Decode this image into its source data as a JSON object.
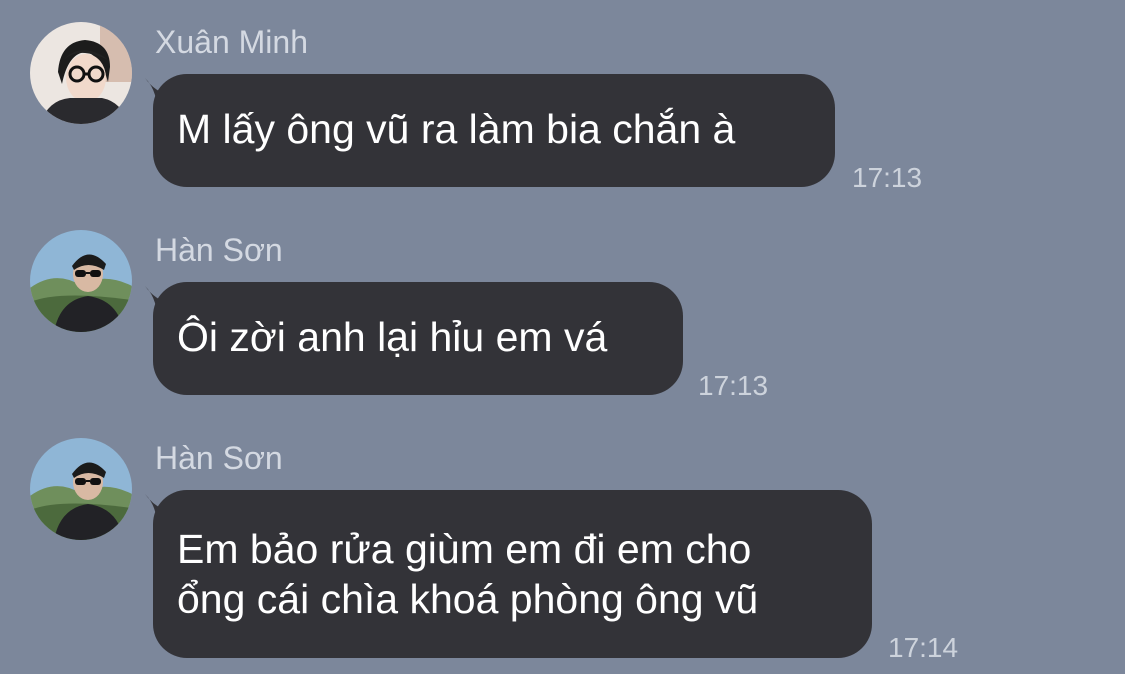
{
  "chat": {
    "background_color": "#7c879b",
    "bubble_color": "#333338",
    "messages": [
      {
        "sender": "Xuân Minh",
        "avatar_icon": "user-avatar-icon",
        "text_lines": [
          "M lấy ông vũ ra làm bia chắn à"
        ],
        "time": "17:13"
      },
      {
        "sender": "Hàn Sơn",
        "avatar_icon": "user-avatar-icon",
        "text_lines": [
          "Ôi zời anh lại hỉu em vá"
        ],
        "time": "17:13"
      },
      {
        "sender": "Hàn Sơn",
        "avatar_icon": "user-avatar-icon",
        "text_lines": [
          "Em bảo rửa giùm em đi em cho",
          "ổng cái chìa khoá phòng ông vũ"
        ],
        "time": "17:14"
      }
    ]
  }
}
